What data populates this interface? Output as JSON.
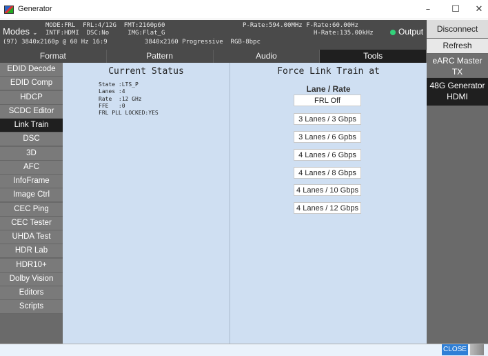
{
  "window": {
    "title": "Generator",
    "minimize": "–",
    "maximize": "☐",
    "close": "✕"
  },
  "status": {
    "modes_label": "Modes",
    "line1a": "MODE:FRL  FRL:4/12G  FMT:2160p60",
    "line1b": "P-Rate:594.00MHz F-Rate:60.00Hz",
    "line2a": "INTF:HDMI  DSC:No     IMG:Flat_G",
    "line2b": "H-Rate:135.00kHz",
    "line3": "(97) 3840x2160p @ 60 Hz 16:9          3840x2160 Progressive  RGB-8bpc",
    "output_label": "Output",
    "output_color": "#33d17a"
  },
  "tabs": [
    {
      "label": "Format",
      "active": false
    },
    {
      "label": "Pattern",
      "active": false
    },
    {
      "label": "Audio",
      "active": false
    },
    {
      "label": "Tools",
      "active": true
    }
  ],
  "sidebar": {
    "items": [
      {
        "label": "EDID Decode"
      },
      {
        "label": "EDID Comp"
      },
      {
        "label": "HDCP"
      },
      {
        "label": "SCDC Editor"
      },
      {
        "label": "Link Train"
      },
      {
        "label": "DSC"
      },
      {
        "label": "3D"
      },
      {
        "label": "AFC"
      },
      {
        "label": "InfoFrame"
      },
      {
        "label": "Image Ctrl"
      },
      {
        "label": "CEC Ping"
      },
      {
        "label": "CEC Tester"
      },
      {
        "label": "UHDA Test"
      },
      {
        "label": "HDR Lab"
      },
      {
        "label": "HDR10+"
      },
      {
        "label": "Dolby Vision"
      },
      {
        "label": "Editors"
      },
      {
        "label": "Scripts"
      }
    ],
    "active_index": 4
  },
  "current_status": {
    "title": "Current Status",
    "lines": "State :LTS_P\nLanes :4\nRate  :12 GHz\nFFE   :0\nFRL PLL LOCKED:YES"
  },
  "force_link_train": {
    "title": "Force Link Train at",
    "header": "Lane / Rate",
    "buttons": [
      "FRL Off",
      "3 Lanes / 3 Gbps",
      "3 Lanes / 6 Gpbs",
      "4 Lanes / 6 Gbps",
      "4 Lanes / 8 Gbps",
      "4 Lanes / 10 Gbps",
      "4 Lanes / 12 Gbps"
    ]
  },
  "right_panel": {
    "disconnect": "Disconnect",
    "refresh": "Refresh",
    "earc_line1": "eARC Master",
    "earc_line2": "TX",
    "gen_line1": "48G Generator",
    "gen_line2": "HDMI"
  },
  "bottom": {
    "close_label": "CLOSE"
  }
}
